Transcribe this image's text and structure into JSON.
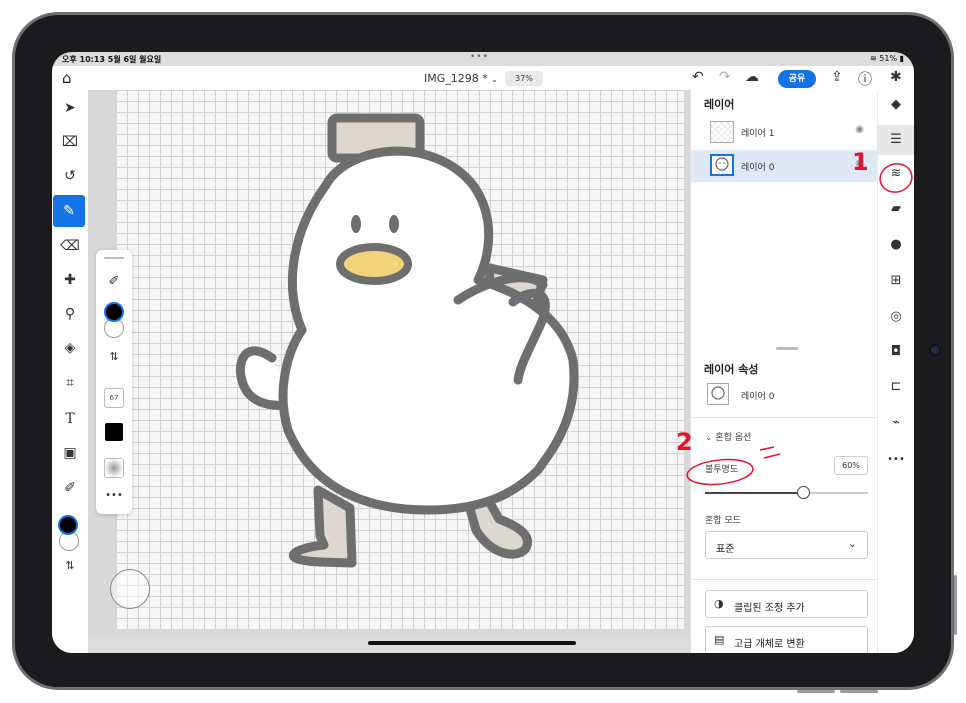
{
  "status_bar": {
    "time": "오후 10:13  5월 6일 월요일",
    "dots": "•••",
    "battery": "51%"
  },
  "top_bar": {
    "document_title": "IMG_1298 *",
    "zoom": "37%",
    "share_label": "공유",
    "icons": [
      "home-icon",
      "undo-icon",
      "redo-icon",
      "cloud-icon",
      "export-icon",
      "help-icon",
      "settings-icon"
    ]
  },
  "left_tools": [
    "select-tool",
    "transform-tool",
    "lasso-tool",
    "brush-tool",
    "eraser-tool",
    "healing-tool",
    "clone-tool",
    "fill-tool",
    "crop-tool",
    "type-tool",
    "place-image-tool",
    "eyedropper-tool",
    "color-swatch",
    "swap-colors"
  ],
  "tool_text": {
    "type": "T"
  },
  "brush_palette": {
    "size": "67",
    "more": "•••"
  },
  "layers_panel": {
    "title": "레이어",
    "layers": [
      {
        "name": "레이어 1",
        "selected": false
      },
      {
        "name": "레이어 0",
        "selected": true
      }
    ]
  },
  "layer_properties": {
    "title": "레이어 속성",
    "layer_name": "레이어 0",
    "blend_options_label": "혼합 옵션",
    "opacity_label": "불투명도",
    "opacity_value": "60%",
    "opacity_fraction": 0.6,
    "blend_mode_label": "혼합 모드",
    "blend_mode_value": "표준",
    "actions": [
      {
        "label": "클립된 조정 추가",
        "icon": "half-circle-icon"
      },
      {
        "label": "고급 개체로 변환",
        "icon": "smart-object-icon"
      }
    ]
  },
  "right_rail": [
    "layers-icon",
    "layer-properties-icon",
    "adjustments-icon",
    "comments-icon",
    "info-icon",
    "add-layer-icon",
    "visibility-icon",
    "mask-icon",
    "merge-icon",
    "clear-icon",
    "more-icon"
  ],
  "annotations": {
    "step1": "1",
    "step2": "2"
  },
  "colors": {
    "accent": "#1473e6",
    "annotation": "#e8102a",
    "duck_outline": "#6e6e6e",
    "beak": "#f1d37a",
    "hat": "#ddd8cf"
  }
}
